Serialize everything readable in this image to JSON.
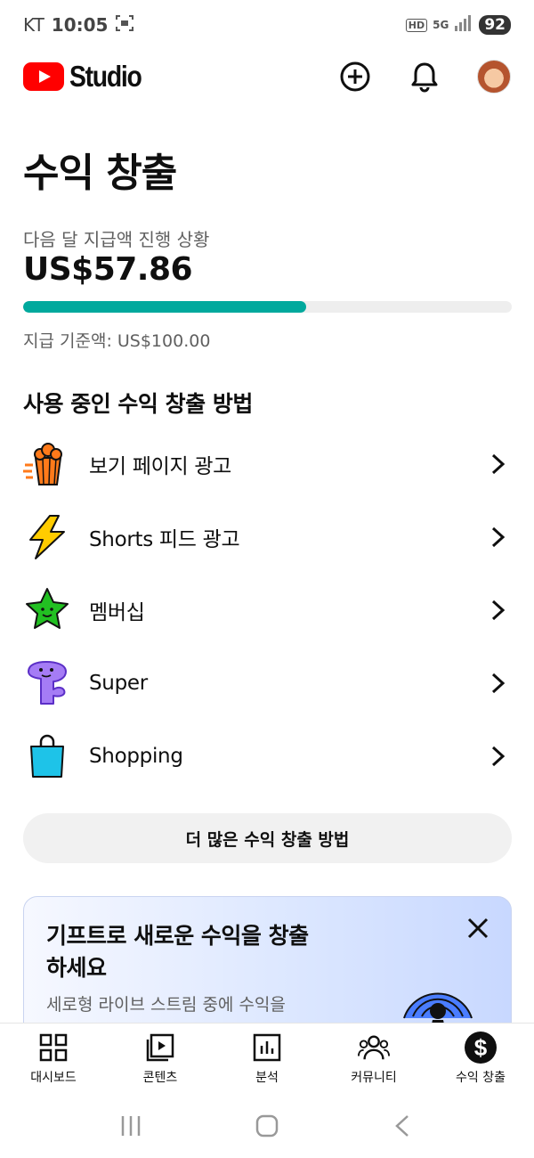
{
  "status_bar": {
    "carrier": "KT",
    "time": "10:05",
    "hd": "HD",
    "network": "5G",
    "battery": "92"
  },
  "header": {
    "logo_text": "Studio"
  },
  "monetization": {
    "title": "수익 창출",
    "progress_label": "다음 달 지급액 진행 상황",
    "amount": "US$57.86",
    "progress_fraction": 0.5786,
    "threshold_text": "지급 기준액: US$100.00"
  },
  "methods_section": {
    "title": "사용 중인 수익 창출 방법",
    "items": [
      {
        "label": "보기 페이지 광고",
        "icon": "popcorn-icon"
      },
      {
        "label": "Shorts 피드 광고",
        "icon": "lightning-icon"
      },
      {
        "label": "멤버십",
        "icon": "star-icon"
      },
      {
        "label": "Super",
        "icon": "super-thanks-icon"
      },
      {
        "label": "Shopping",
        "icon": "shopping-bag-icon"
      }
    ]
  },
  "more_button": {
    "label": "더 많은 수익 창출 방법"
  },
  "promo": {
    "title": "기프트로 새로운 수익을 창출하세요",
    "description": "세로형 라이브 스트림 중에 수익을"
  },
  "bottom_nav": {
    "items": [
      {
        "label": "대시보드",
        "icon": "dashboard-icon"
      },
      {
        "label": "콘텐츠",
        "icon": "content-icon"
      },
      {
        "label": "분석",
        "icon": "analytics-icon"
      },
      {
        "label": "커뮤니티",
        "icon": "community-icon"
      },
      {
        "label": "수익 창출",
        "icon": "dollar-icon",
        "active": true
      }
    ]
  },
  "colors": {
    "brand_red": "#ff0000",
    "progress_fill": "#00a99d",
    "progress_track": "#eeeeee",
    "promo_bg": "#dce7ff"
  }
}
